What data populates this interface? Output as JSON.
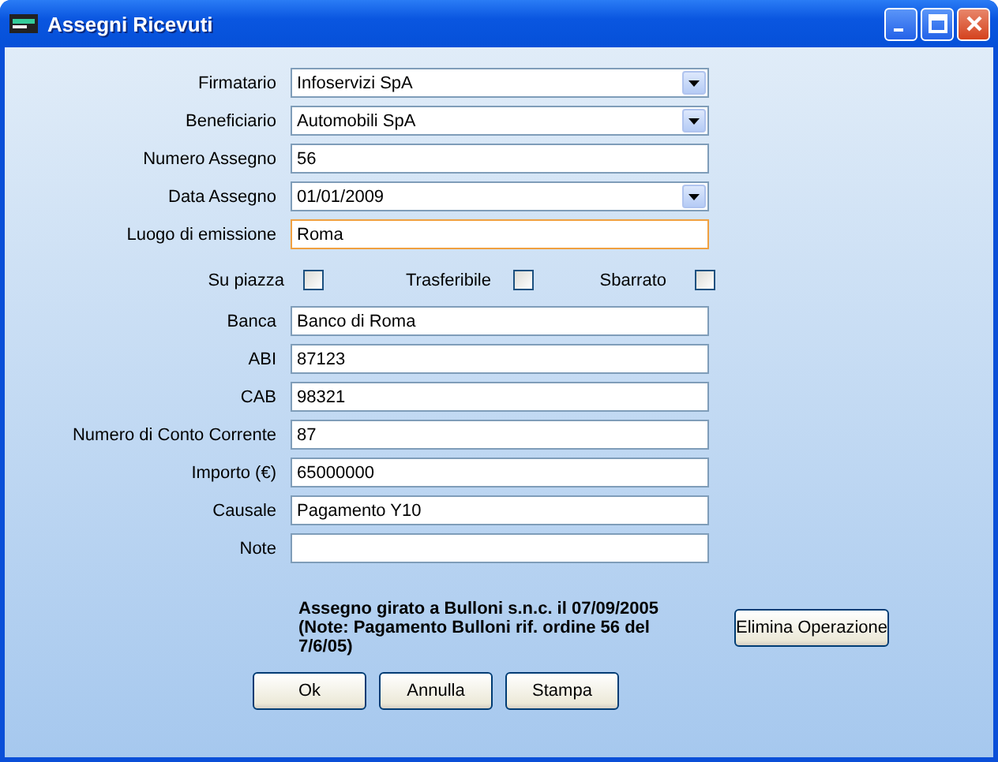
{
  "window": {
    "title": "Assegni Ricevuti"
  },
  "fields": [
    {
      "label": "Firmatario",
      "value": "Infoservizi SpA",
      "kind": "dropdown",
      "focused": false
    },
    {
      "label": "Beneficiario",
      "value": "Automobili SpA",
      "kind": "dropdown",
      "focused": false
    },
    {
      "label": "Numero Assegno",
      "value": "56",
      "kind": "text",
      "focused": false
    },
    {
      "label": "Data Assegno",
      "value": "01/01/2009",
      "kind": "dropdown",
      "focused": false
    },
    {
      "label": "Luogo di emissione",
      "value": "Roma",
      "kind": "text",
      "focused": true
    }
  ],
  "checkboxes": [
    {
      "label": "Su piazza",
      "checked": false
    },
    {
      "label": "Trasferibile",
      "checked": false
    },
    {
      "label": "Sbarrato",
      "checked": false
    }
  ],
  "fields_2": [
    {
      "label": "Banca",
      "value": "Banco di Roma",
      "kind": "text",
      "focused": false
    },
    {
      "label": "ABI",
      "value": "87123",
      "kind": "text",
      "focused": false
    },
    {
      "label": "CAB",
      "value": "98321",
      "kind": "text",
      "focused": false
    },
    {
      "label": "Numero di Conto Corrente",
      "value": "87",
      "kind": "text",
      "focused": false
    },
    {
      "label": "Importo (€)",
      "value": "65000000",
      "kind": "text",
      "focused": false
    },
    {
      "label": "Causale",
      "value": "Pagamento Y10",
      "kind": "text",
      "focused": false
    },
    {
      "label": "Note",
      "kind": "text",
      "focused": false
    }
  ],
  "note": "Assegno girato a Bulloni s.n.c.  il 07/09/2005 (Note: Pagamento Bulloni rif. ordine 56 del 7/6/05)",
  "side_button": "Elimina Operazione",
  "buttons": [
    "Ok",
    "Annulla",
    "Stampa"
  ]
}
